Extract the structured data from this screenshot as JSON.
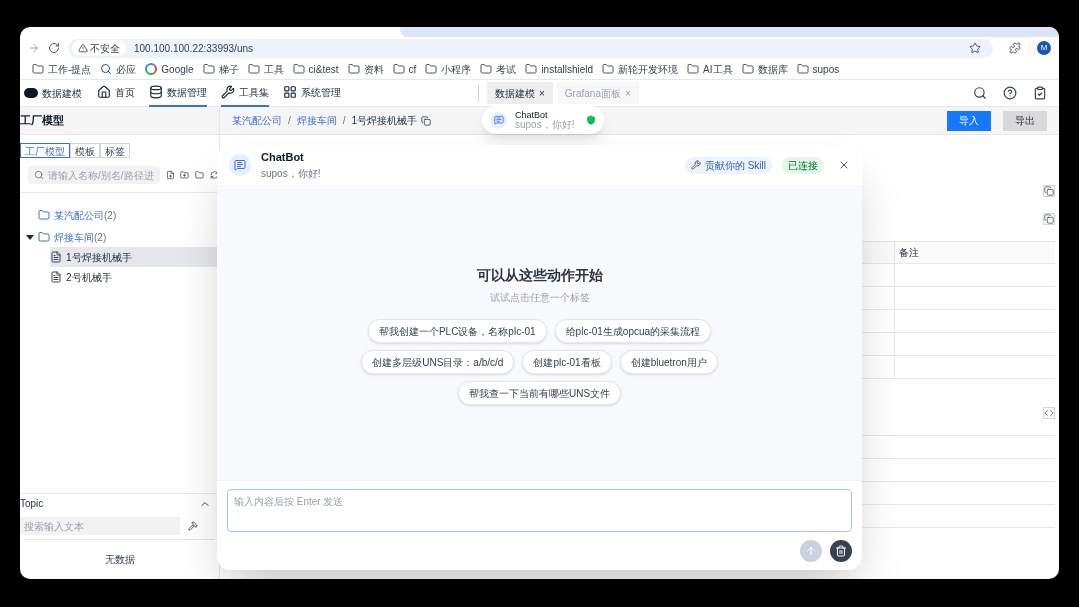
{
  "browser": {
    "security": "不安全",
    "url": "100.100.100.22:33993/uns",
    "avatar": "M",
    "bookmarks": [
      {
        "kind": "folder",
        "label": "工作-提点"
      },
      {
        "kind": "search",
        "label": "必应"
      },
      {
        "kind": "google",
        "label": "Google"
      },
      {
        "kind": "folder",
        "label": "梯子"
      },
      {
        "kind": "folder",
        "label": "工具"
      },
      {
        "kind": "folder",
        "label": "ci&test"
      },
      {
        "kind": "folder",
        "label": "资料"
      },
      {
        "kind": "folder",
        "label": "cf"
      },
      {
        "kind": "folder",
        "label": "小程序"
      },
      {
        "kind": "folder",
        "label": "考试"
      },
      {
        "kind": "folder",
        "label": "installshield"
      },
      {
        "kind": "folder",
        "label": "新轮开发环境"
      },
      {
        "kind": "folder",
        "label": "AI工具"
      },
      {
        "kind": "folder",
        "label": "数据库"
      },
      {
        "kind": "folder",
        "label": "supos"
      }
    ]
  },
  "app": {
    "logo": "数据建模",
    "nav": [
      {
        "kind": "home",
        "label": "首页",
        "selected": false
      },
      {
        "kind": "data",
        "label": "数据管理",
        "selected": true
      },
      {
        "kind": "tools",
        "label": "工具集",
        "selected": true
      },
      {
        "kind": "system",
        "label": "系统管理",
        "selected": false
      }
    ],
    "tabs": [
      {
        "label": "数据建模",
        "close": "×",
        "selected": true
      },
      {
        "label": "Grafana面板",
        "close": "×",
        "selected": false
      }
    ]
  },
  "sidebar": {
    "title": "工厂模型",
    "tabs": [
      {
        "label": "工厂模型",
        "selected": true
      },
      {
        "label": "模板",
        "selected": false
      },
      {
        "label": "标签",
        "selected": false
      }
    ],
    "search": {
      "placeholder": "请输入名称/别名/路径进"
    },
    "tree": [
      {
        "label": "某汽配公司",
        "count": "(2)",
        "kind": "folder",
        "selected": false
      },
      {
        "label": "焊接车间",
        "count": "(2)",
        "kind": "folder",
        "expanded": true,
        "selected": false,
        "children": [
          {
            "label": "1号焊接机械手",
            "kind": "file",
            "selected": true
          },
          {
            "label": "2号机械手",
            "kind": "file",
            "selected": false
          }
        ]
      }
    ],
    "topic": {
      "title": "Topic",
      "placeholder": "搜索输入文本",
      "empty": "无数据"
    }
  },
  "breadcrumb": {
    "separator": "/",
    "items": [
      "某汽配公司",
      "焊接车间",
      "1号焊接机械手"
    ]
  },
  "actions": [
    {
      "label": "导入",
      "primary": true
    },
    {
      "label": "导出",
      "primary": false
    }
  ],
  "table": {
    "columns": [
      "备注"
    ]
  },
  "chatbot_pill": {
    "title": "ChatBot",
    "subtitle": "supos，你好!"
  },
  "chat": {
    "title": "ChatBot",
    "subtitle": "supos，你好!",
    "skill": "贡献你的 Skill",
    "status": "已连接",
    "connected": true,
    "heading": "可以从这些动作开始",
    "hint": "试试点击任意一个标签",
    "suggestions": [
      [
        "帮我创建一个PLC设备，名称plc-01",
        "给plc-01生成opcua的采集流程"
      ],
      [
        "创建多层级UNS目录：a/b/c/d",
        "创建plc-01看板",
        "创建bluetron用户"
      ],
      [
        "帮我查一下当前有哪些UNS文件"
      ]
    ],
    "input": {
      "placeholder": "输入内容后按 Enter 发送"
    }
  }
}
